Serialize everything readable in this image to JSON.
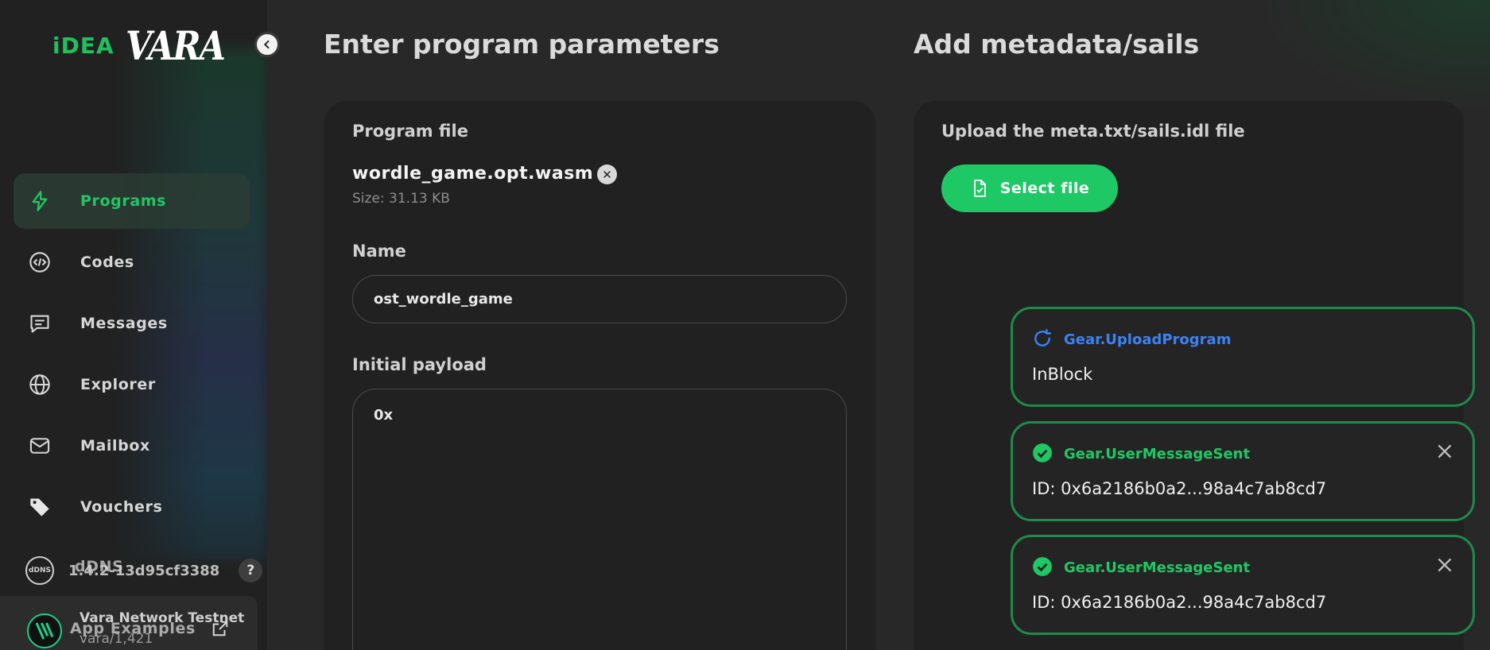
{
  "brand": {
    "idea_label": "iDEA",
    "vara_label": "VARA"
  },
  "sidebar": {
    "items": [
      {
        "label": "Programs",
        "icon": "lightning-icon"
      },
      {
        "label": "Codes",
        "icon": "code-icon"
      },
      {
        "label": "Messages",
        "icon": "message-icon"
      },
      {
        "label": "Explorer",
        "icon": "globe-icon"
      },
      {
        "label": "Mailbox",
        "icon": "mail-icon"
      },
      {
        "label": "Vouchers",
        "icon": "tag-icon"
      }
    ],
    "dns_label": "dDNS",
    "app_examples_label": "App Examples",
    "version": "1.4.2-13d95cf3388",
    "help_badge": "?",
    "network": {
      "name": "Vara Network Testnet",
      "id": "vara/1,421"
    }
  },
  "program": {
    "section_title": "Enter program parameters",
    "file_label": "Program file",
    "file_name": "wordle_game.opt.wasm",
    "file_size": "Size: 31.13 KB",
    "name_label": "Name",
    "name_value": "ost_wordle_game",
    "payload_label": "Initial payload",
    "payload_value": "0x"
  },
  "metadata": {
    "section_title": "Add metadata/sails",
    "upload_label": "Upload the meta.txt/sails.idl file",
    "select_button": "Select file"
  },
  "toasts": [
    {
      "title": "Gear.UploadProgram",
      "body": "InBlock",
      "status": "pending",
      "color": "#3b82f6"
    },
    {
      "title": "Gear.UserMessageSent",
      "body": "ID: 0x6a2186b0a2...98a4c7ab8cd7",
      "status": "success",
      "color": "#1ec965"
    },
    {
      "title": "Gear.UserMessageSent",
      "body": "ID: 0x6a2186b0a2...98a4c7ab8cd7",
      "status": "success",
      "color": "#1ec965"
    }
  ],
  "colors": {
    "accent": "#1ec965",
    "info": "#3b82f6",
    "background": "#282828",
    "card": "#212121"
  }
}
